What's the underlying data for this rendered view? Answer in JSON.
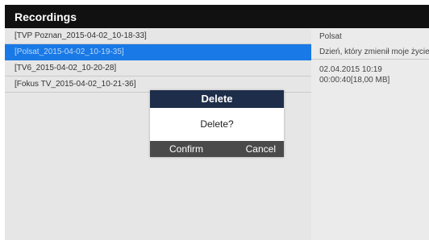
{
  "header": {
    "title": "Recordings"
  },
  "recordings": [
    {
      "label": "[TVP Poznan_2015-04-02_10-18-33]"
    },
    {
      "label": "[Polsat_2015-04-02_10-19-35]"
    },
    {
      "label": "[TV6_2015-04-02_10-20-28]"
    },
    {
      "label": "[Fokus TV_2015-04-02_10-21-36]"
    }
  ],
  "selected_index": 1,
  "details": {
    "channel": "Polsat",
    "program": "Dzień, który zmienił moje życie",
    "date": "02.04.2015 10:19",
    "duration_size": "00:00:40[18,00 MB]"
  },
  "dialog": {
    "title": "Delete",
    "message": "Delete?",
    "confirm_label": "Confirm",
    "cancel_label": "Cancel"
  },
  "colors": {
    "title_bar": "#111111",
    "selection": "#1979e6",
    "dialog_header": "#1e2e4a",
    "dialog_footer": "#4a4a4a"
  }
}
